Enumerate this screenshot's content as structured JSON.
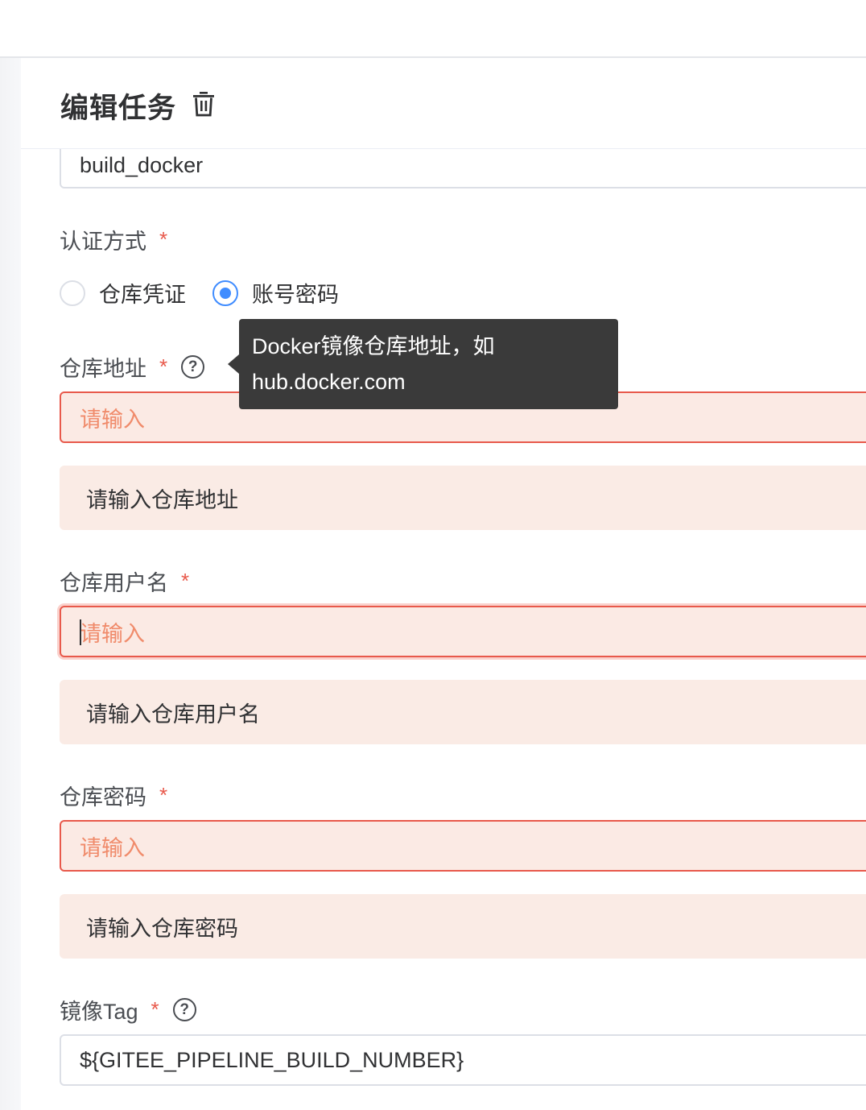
{
  "panel": {
    "title": "编辑任务"
  },
  "fields": {
    "task_name_value": "build_docker",
    "auth": {
      "label": "认证方式",
      "required": "*",
      "options": [
        {
          "label": "仓库凭证",
          "checked": false
        },
        {
          "label": "账号密码",
          "checked": true
        }
      ]
    },
    "repo_address": {
      "label": "仓库地址",
      "required": "*",
      "help": "?",
      "placeholder": "请输入",
      "error": "请输入仓库地址"
    },
    "repo_username": {
      "label": "仓库用户名",
      "required": "*",
      "placeholder": "请输入",
      "error": "请输入仓库用户名"
    },
    "repo_password": {
      "label": "仓库密码",
      "required": "*",
      "placeholder": "请输入",
      "error": "请输入仓库密码"
    },
    "image_tag": {
      "label": "镜像Tag",
      "required": "*",
      "help": "?",
      "value": "${GITEE_PIPELINE_BUILD_NUMBER}"
    }
  },
  "tooltip": {
    "line1": "Docker镜像仓库地址，如",
    "line2": "hub.docker.com"
  },
  "colors": {
    "accent": "#3f8cff",
    "error": "#e8594b",
    "error_bg": "#faebe5",
    "tooltip_bg": "#3a3a3a"
  },
  "icons": [
    "trash-icon",
    "help-icon",
    "radio-unchecked",
    "radio-checked"
  ]
}
